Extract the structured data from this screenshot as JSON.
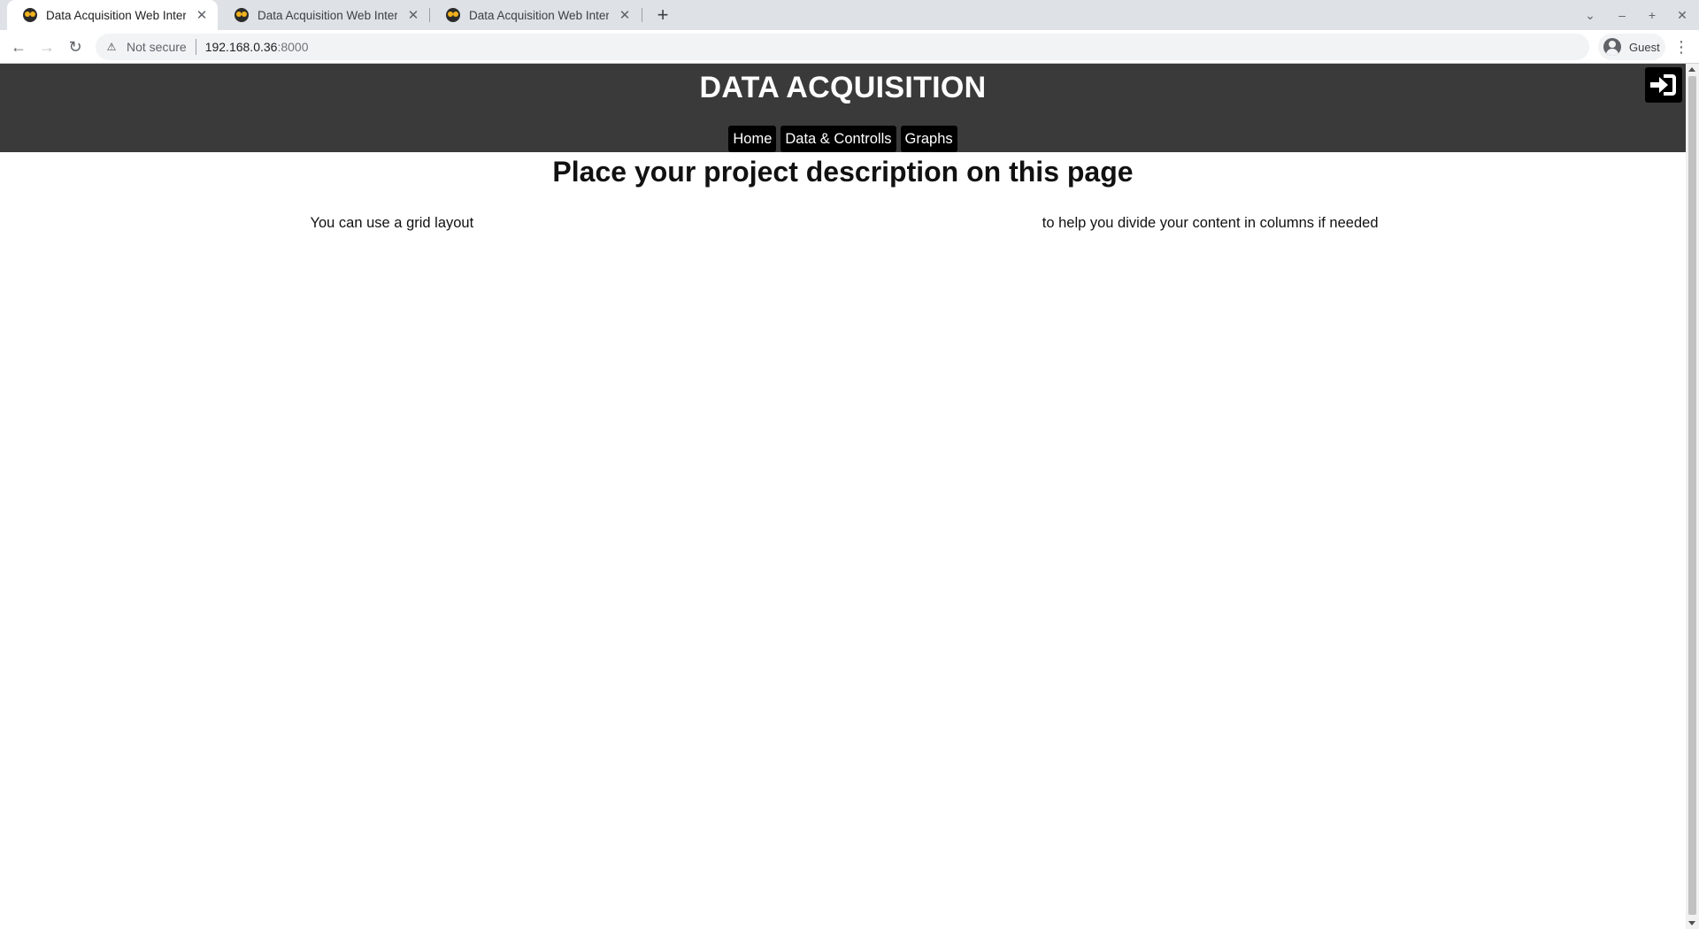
{
  "browser": {
    "tabs": [
      {
        "title": "Data Acquisition Web Interface",
        "active": true
      },
      {
        "title": "Data Acquisition Web Interface",
        "active": false
      },
      {
        "title": "Data Acquisition Web Interface",
        "active": false
      }
    ],
    "new_tab_icon": "plus-icon",
    "address": {
      "security_label": "Not secure",
      "host": "192.168.0.36",
      "port": ":8000"
    },
    "profile_label": "Guest"
  },
  "site": {
    "title": "DATA ACQUISITION",
    "nav": [
      "Home",
      "Data & Controlls",
      "Graphs"
    ],
    "login_icon": "sign-in-icon",
    "header_color": "#3a3a3a",
    "nav_button_color": "#000000"
  },
  "main": {
    "heading": "Place your project description on this page",
    "left_text": "You can use a grid layout",
    "right_text": "to help you divide your content in columns if needed"
  }
}
